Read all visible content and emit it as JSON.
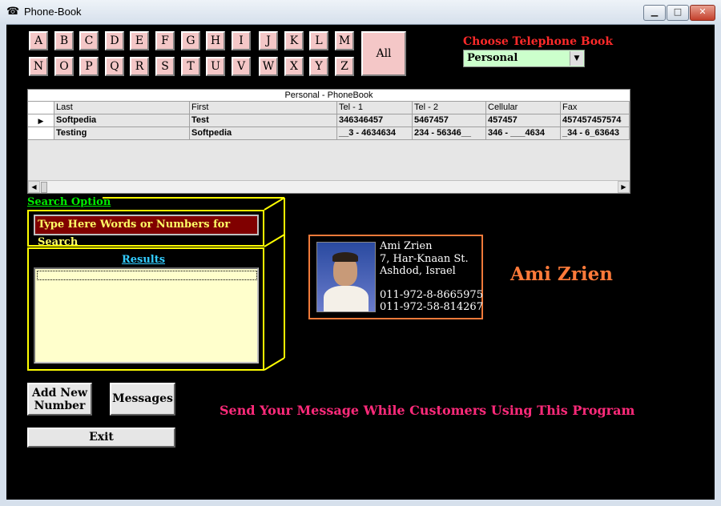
{
  "window": {
    "title": "Phone-Book",
    "app_icon": "phone-icon",
    "controls": {
      "minimize": "▁",
      "maximize": "□",
      "close": "✕"
    }
  },
  "letters_row1": [
    "A",
    "B",
    "C",
    "D",
    "E",
    "F",
    "G",
    "H",
    "I",
    "J",
    "K",
    "L",
    "M"
  ],
  "letters_row2": [
    "N",
    "O",
    "P",
    "Q",
    "R",
    "S",
    "T",
    "U",
    "V",
    "W",
    "X",
    "Y",
    "Z"
  ],
  "all_button": "All",
  "book": {
    "label": "Choose Telephone Book",
    "selected": "Personal"
  },
  "grid": {
    "caption": "Personal  -  PhoneBook",
    "columns": [
      "Last",
      "First",
      "Tel - 1",
      "Tel - 2",
      "Cellular",
      "Fax"
    ],
    "rows": [
      [
        "Softpedia",
        "Test",
        "346346457",
        "5467457",
        "457457",
        "457457457574"
      ],
      [
        "Testing",
        "Softpedia",
        "__3 - 4634634",
        "234 - 56346__",
        "346 - ___4634",
        "_34 - 6_63643"
      ]
    ],
    "current_row_marker": "▶"
  },
  "search": {
    "title": "Search Option",
    "placeholder": "Type Here Words or Numbers for Search",
    "results_title": "Results"
  },
  "card": {
    "name": "Ami Zrien",
    "address1": "7, Har-Knaan St.",
    "address2": "Ashdod, Israel",
    "phone1": "011-972-8-8665975",
    "phone2": "011-972-58-814267"
  },
  "big_name": "Ami Zrien",
  "promo": "Send Your Message While Customers Using This Program",
  "buttons": {
    "add_line1": "Add New",
    "add_line2": "Number",
    "messages": "Messages",
    "exit": "Exit"
  },
  "colors": {
    "background": "#000000",
    "letter_button": "#f4c7c7",
    "grid_row": "#ccffff",
    "search_frame": "#ffff00",
    "card_border": "#f07a3a",
    "promo": "#ff2a7a"
  }
}
